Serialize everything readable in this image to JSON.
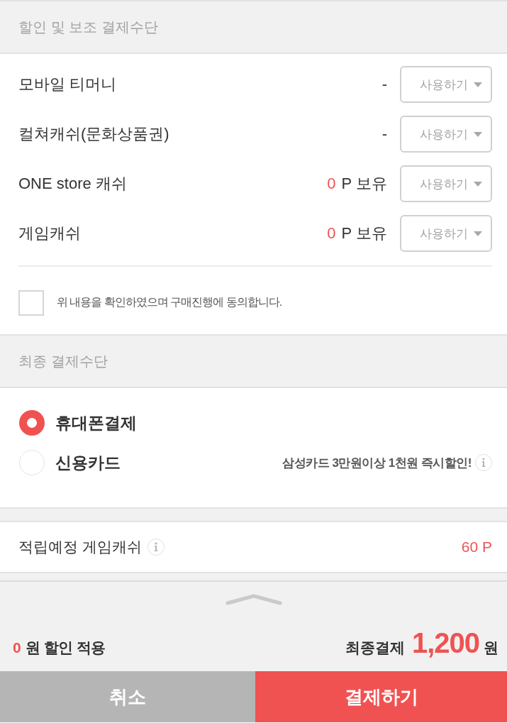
{
  "discount_section": {
    "title": "할인 및 보조 결제수단",
    "items": [
      {
        "kind": "plain",
        "label": "모바일 티머니",
        "value": "-",
        "action": "사용하기"
      },
      {
        "kind": "plain",
        "label": "컬쳐캐쉬(문화상품권)",
        "value": "-",
        "action": "사용하기"
      },
      {
        "kind": "points",
        "label": "ONE store 캐쉬",
        "amount": "0",
        "unit": "P 보유",
        "action": "사용하기"
      },
      {
        "kind": "points",
        "label": "게임캐쉬",
        "amount": "0",
        "unit": "P 보유",
        "action": "사용하기"
      }
    ],
    "agreement": {
      "text": "위 내용을 확인하였으며 구매진행에 동의합니다.",
      "checked": false
    }
  },
  "payment_section": {
    "title": "최종 결제수단",
    "options": [
      {
        "label": "휴대폰결제",
        "selected": true
      },
      {
        "label": "신용카드",
        "selected": false,
        "promo": "삼성카드 3만원이상 1천원 즉시할인!"
      }
    ]
  },
  "reward": {
    "label": "적립예정 게임캐쉬",
    "value": "60 P"
  },
  "summary": {
    "discount_amount": "0",
    "discount_text": "원 할인 적용",
    "total_label": "최종결제",
    "total_amount": "1,200",
    "total_unit": "원"
  },
  "buttons": [
    {
      "kind": "cancel",
      "label": "취소"
    },
    {
      "kind": "primary",
      "label": "결제하기"
    }
  ]
}
